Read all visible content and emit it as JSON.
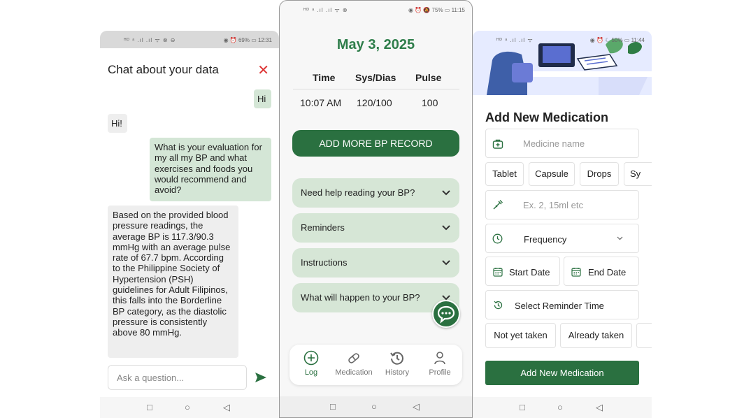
{
  "chat_screen": {
    "status": {
      "left": "ᴴᴰ ᵃ .ıl .ıl ᯤ ⊗ ⊖",
      "right": "◉ ⏰ 69% ▭ 12:31"
    },
    "title": "Chat about your data",
    "messages": [
      {
        "role": "user",
        "text": "Hi"
      },
      {
        "role": "bot",
        "text": "Hi!"
      },
      {
        "role": "user",
        "text": "What is your evaluation for my all my BP and what exercises and foods you would recommend and avoid?"
      },
      {
        "role": "bot",
        "text": "Based on the provided blood pressure readings, the average BP is 117.3/90.3 mmHg with an average pulse rate of 67.7 bpm. According to the Philippine Society of Hypertension (PSH) guidelines for Adult Filipinos, this falls into the Borderline BP category, as the diastolic pressure is consistently above 80 mmHg."
      }
    ],
    "input_placeholder": "Ask a question..."
  },
  "bp_screen": {
    "status": {
      "left": "ᴴᴰ ᵃ .ıl .ıl ᯤ ⊗",
      "right": "◉ ⏰ 🔕 75% ▭ 11:15"
    },
    "date": "May 3, 2025",
    "table": {
      "headers": [
        "Time",
        "Sys/Dias",
        "Pulse"
      ],
      "rows": [
        [
          "10:07 AM",
          "120/100",
          "100"
        ]
      ]
    },
    "add_button": "ADD MORE BP RECORD",
    "accordions": [
      "Need help reading your BP?",
      "Reminders",
      "Instructions",
      "What will happen to your BP?"
    ],
    "nav": [
      "Log",
      "Medication",
      "History",
      "Profile"
    ],
    "active_nav": "Log",
    "accent": "#2a7040"
  },
  "med_screen": {
    "status": {
      "left": "ᴴᴰ ᵃ .ıl .ıl ᯤ",
      "right": "◉ ⏰ ☾ 50% ▭ 11:44"
    },
    "heading": "Add New Medication",
    "medicine_placeholder": "Medicine name",
    "forms": [
      "Tablet",
      "Capsule",
      "Drops",
      "Sy"
    ],
    "dose_placeholder": "Ex. 2, 15ml etc",
    "frequency_label": "Frequency",
    "start_date": "Start Date",
    "end_date": "End Date",
    "reminder_time": "Select Reminder Time",
    "status_chips": [
      "Not yet taken",
      "Already taken"
    ],
    "submit": "Add New Medication"
  }
}
